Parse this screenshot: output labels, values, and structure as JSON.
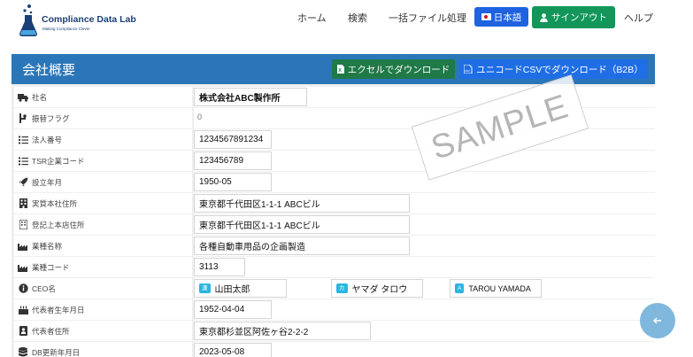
{
  "brand": {
    "title": "Compliance Data Lab",
    "subtitle": "Making Compliance Clever"
  },
  "nav": {
    "home": "ホーム",
    "search": "検索",
    "batch": "一括ファイル処理",
    "lang": "日本語",
    "signin": "サインアウト",
    "help": "ヘルプ"
  },
  "card": {
    "title": "会社概要",
    "excel_btn": "エクセルでダウンロード",
    "csv_btn": "ユニコードCSVでダウンロード（B2B）"
  },
  "fields": {
    "company_name": {
      "label": "社名",
      "value": "株式会社ABC製作所"
    },
    "transfer_flag": {
      "label": "振替フラグ",
      "value": "0"
    },
    "corp_number": {
      "label": "法人番号",
      "value": "1234567891234"
    },
    "tsr_code": {
      "label": "TSR企業コード",
      "value": "123456789"
    },
    "established": {
      "label": "設立年月",
      "value": "1950-05"
    },
    "hq_address": {
      "label": "実質本社住所",
      "value": "東京都千代田区1-1-1 ABCビル"
    },
    "registered_address": {
      "label": "登記上本店住所",
      "value": "東京都千代田区1-1-1 ABCビル"
    },
    "industry_name": {
      "label": "業種名称",
      "value": "各種自動車用品の企画製造"
    },
    "industry_code": {
      "label": "業種コード",
      "value": "3113"
    },
    "ceo": {
      "label": "CEO名",
      "kanji_tag": "漢",
      "kanji": "山田太郎",
      "kana_tag": "カ",
      "kana": "ヤマダ タロウ",
      "alpha_tag": "A",
      "alpha": "TAROU YAMADA"
    },
    "ceo_birth": {
      "label": "代表者生年月日",
      "value": "1952-04-04"
    },
    "ceo_address": {
      "label": "代表者住所",
      "value": "東京都杉並区阿佐ヶ谷2-2-2"
    },
    "db_updated": {
      "label": "DB更新年月日",
      "value": "2023-05-08"
    }
  },
  "watermark": "SAMPLE",
  "icons": {
    "company": "truck-icon",
    "flag": "code-branch-icon",
    "list": "list-ol-icon",
    "rocket": "rocket-icon",
    "building": "building-icon",
    "industry": "industry-icon",
    "info": "info-circle-icon",
    "birthday": "birthday-cake-icon",
    "id": "id-card-icon",
    "database": "database-icon"
  },
  "colors": {
    "header_blue": "#2b76b8",
    "excel_green": "#1f7a48",
    "csv_blue": "#1f6ee6",
    "signin_green": "#12965a",
    "lang_blue": "#1e62e0"
  }
}
